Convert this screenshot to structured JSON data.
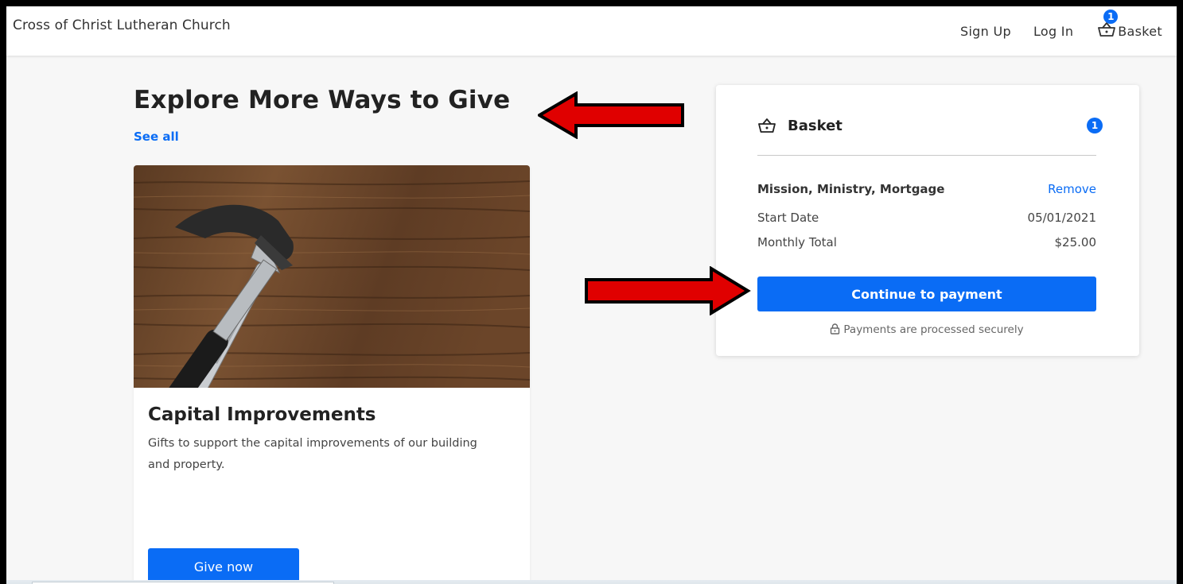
{
  "header": {
    "church_name": "Cross of Christ Lutheran Church",
    "sign_up": "Sign Up",
    "log_in": "Log In",
    "basket_label": "Basket",
    "basket_count": "1"
  },
  "explore": {
    "heading": "Explore More Ways to Give",
    "see_all": "See all"
  },
  "card": {
    "title": "Capital Improvements",
    "description": "Gifts to support the capital improvements of our building and property.",
    "button": "Give now"
  },
  "basket": {
    "title": "Basket",
    "count": "1",
    "item_name": "Mission, Ministry, Mortgage",
    "remove": "Remove",
    "start_date_label": "Start Date",
    "start_date_value": "05/01/2021",
    "monthly_total_label": "Monthly Total",
    "monthly_total_value": "$25.00",
    "continue_button": "Continue to payment",
    "secure_note": "Payments are processed securely"
  },
  "colors": {
    "accent": "#0a6cf5",
    "annotation_arrow": "#e00000"
  },
  "icons": [
    "basket-icon",
    "lock-icon",
    "hammer-wrench-image"
  ]
}
